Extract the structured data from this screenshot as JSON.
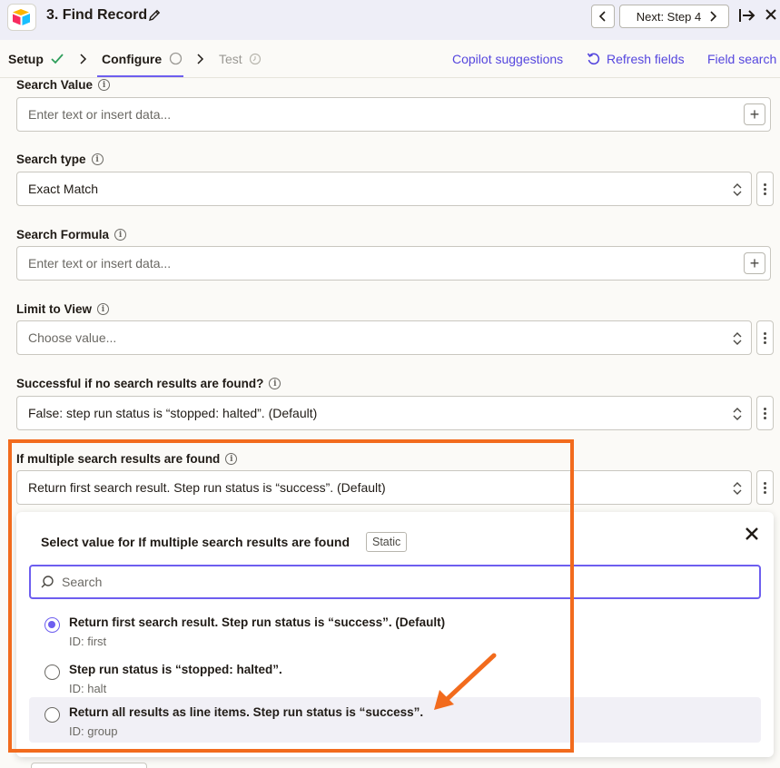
{
  "header": {
    "title": "3. Find Record",
    "next_label": "Next: Step 4"
  },
  "tabs": {
    "setup": "Setup",
    "configure": "Configure",
    "test": "Test"
  },
  "links": {
    "copilot": "Copilot suggestions",
    "refresh": "Refresh fields",
    "field_search": "Field search"
  },
  "fields": {
    "search_value": {
      "label": "Search Value",
      "placeholder": "Enter text or insert data..."
    },
    "search_type": {
      "label": "Search type",
      "value": "Exact Match"
    },
    "search_formula": {
      "label": "Search Formula",
      "placeholder": "Enter text or insert data..."
    },
    "limit_to_view": {
      "label": "Limit to View",
      "placeholder": "Choose value..."
    },
    "successful_if_none": {
      "label": "Successful if no search results are found?",
      "value": "False: step run status is “stopped: halted”. (Default)"
    },
    "multiple_results": {
      "label": "If multiple search results are found",
      "value": "Return first search result. Step run status is “success”. (Default)"
    }
  },
  "dropdown": {
    "title": "Select value for If multiple search results are found",
    "badge": "Static",
    "search_placeholder": "Search",
    "options": [
      {
        "label": "Return first search result. Step run status is “success”. (Default)",
        "id": "ID: first",
        "selected": true
      },
      {
        "label": "Step run status is “stopped: halted”.",
        "id": "ID: halt",
        "selected": false
      },
      {
        "label": "Return all results as line items. Step run status is “success”.",
        "id": "ID: group",
        "selected": false
      }
    ]
  },
  "colors": {
    "accent": "#6d5eef",
    "annotation": "#f26b1d",
    "success_check": "#2e9e5b"
  }
}
